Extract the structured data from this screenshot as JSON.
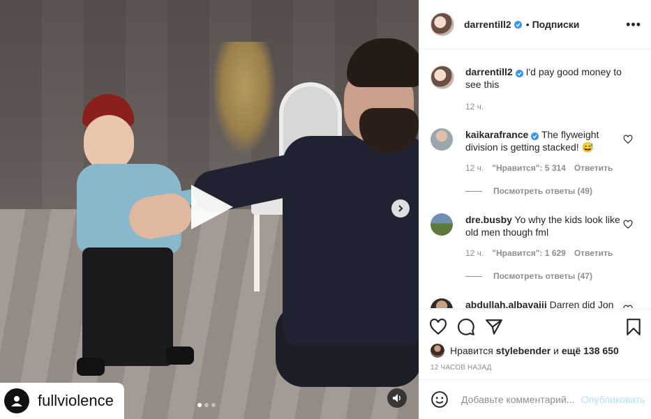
{
  "colors": {
    "accent": "#0095f6",
    "verified": "#3897f0",
    "muted": "#8e8e8e",
    "publish_disabled": "#b2dffc"
  },
  "media": {
    "watermark_text": "fullviolence",
    "carousel_dots": 3,
    "carousel_active_index": 0,
    "icons": {
      "play": "play-icon",
      "next": "chevron-right-icon",
      "sound": "speaker-icon",
      "watermark": "user-icon"
    }
  },
  "header": {
    "username": "darrentill2",
    "separator": "•",
    "follow_label": "Подписки",
    "more_label": "•••"
  },
  "caption": {
    "username": "darrentill2",
    "text": "I'd pay good money to see this",
    "time": "12 ч."
  },
  "comments": [
    {
      "username": "kaikarafrance",
      "verified": true,
      "text": "The flyweight division is getting stacked! 😅",
      "time": "12 ч.",
      "likes": "\"Нравится\": 5 314",
      "reply_label": "Ответить",
      "view_replies": "Посмотреть ответы (49)"
    },
    {
      "username": "dre.busby",
      "verified": false,
      "text": "Yo why the kids look like old men though fml",
      "time": "12 ч.",
      "likes": "\"Нравится\": 1 629",
      "reply_label": "Ответить",
      "view_replies": "Посмотреть ответы (47)"
    },
    {
      "username": "abdullah.albavaiii",
      "verified": false,
      "text": "Darren did Jon"
    }
  ],
  "actions": {
    "icons": [
      "heart-icon",
      "comment-icon",
      "share-icon",
      "bookmark-icon"
    ],
    "likes_prefix": "Нравится",
    "likes_user": "stylebender",
    "likes_middle": "и",
    "likes_count": "ещё 138 650",
    "timestamp": "12 ЧАСОВ НАЗАД"
  },
  "add_comment": {
    "placeholder": "Добавьте комментарий...",
    "publish_label": "Опубликовать"
  }
}
